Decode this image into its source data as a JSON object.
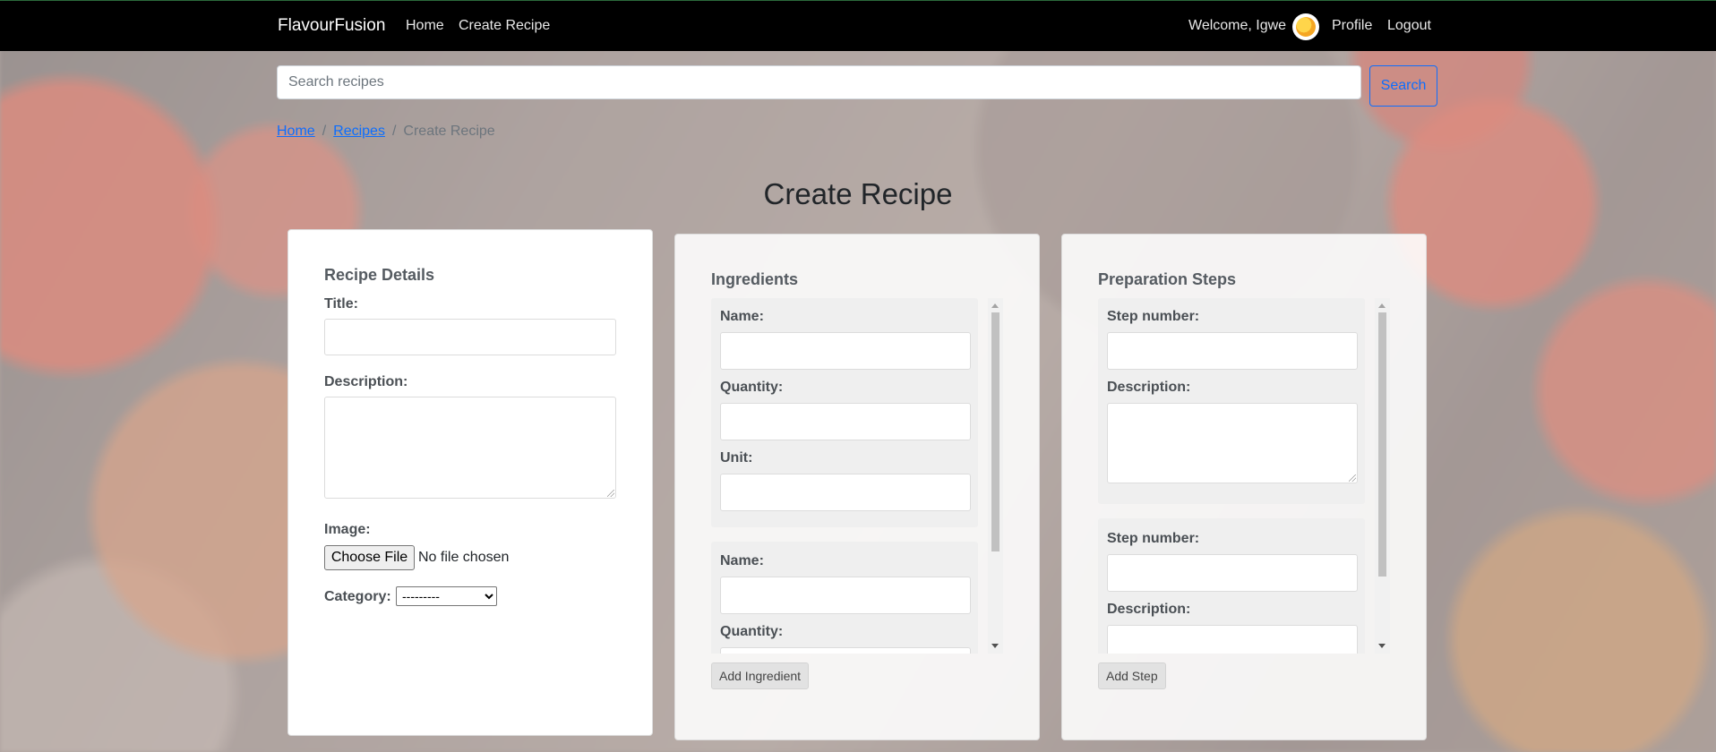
{
  "navbar": {
    "brand": "FlavourFusion",
    "links": [
      "Home",
      "Create Recipe"
    ],
    "welcome": "Welcome, Igwe",
    "profile": "Profile",
    "logout": "Logout"
  },
  "search": {
    "placeholder": "Search recipes",
    "button": "Search"
  },
  "breadcrumb": {
    "home": "Home",
    "recipes": "Recipes",
    "current": "Create Recipe",
    "separator": "/"
  },
  "page_title": "Create Recipe",
  "recipe_details": {
    "title": "Recipe Details",
    "title_label": "Title:",
    "description_label": "Description:",
    "image_label": "Image:",
    "choose_file": "Choose File",
    "no_file": "No file chosen",
    "category_label": "Category:",
    "category_selected": "---------"
  },
  "ingredients": {
    "title": "Ingredients",
    "name_label": "Name:",
    "quantity_label": "Quantity:",
    "unit_label": "Unit:",
    "add_button": "Add Ingredient"
  },
  "steps": {
    "title": "Preparation Steps",
    "step_number_label": "Step number:",
    "description_label": "Description:",
    "add_button": "Add Step"
  }
}
